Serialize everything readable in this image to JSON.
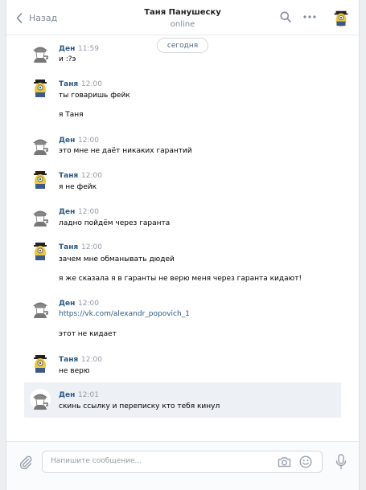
{
  "header": {
    "back_label": "Назад",
    "title": "Таня Панушеску",
    "status": "online"
  },
  "date_pill": "сегодня",
  "messages": [
    {
      "name": "Ден",
      "time": "11:59",
      "lines": [
        "и :?э"
      ]
    },
    {
      "name": "Таня",
      "time": "12:00",
      "lines": [
        "ты говаришь фейк",
        "я Таня"
      ]
    },
    {
      "name": "Ден",
      "time": "12:00",
      "lines": [
        "это мне не даёт никаких гарантий"
      ]
    },
    {
      "name": "Таня",
      "time": "12:00",
      "lines": [
        "я не фейк"
      ]
    },
    {
      "name": "Ден",
      "time": "12:00",
      "lines": [
        "ладно пойдём через гаранта"
      ]
    },
    {
      "name": "Таня",
      "time": "12:00",
      "lines": [
        "зачем мне обманывать дюдей",
        "я же сказала я в гаранты не верю меня через гаранта кидают!"
      ]
    },
    {
      "name": "Ден",
      "time": "12:00",
      "link": "https://vk.com/alexandr_popovich_1",
      "lines": [
        "этот не кидает"
      ]
    },
    {
      "name": "Таня",
      "time": "12:00",
      "lines": [
        "не верю"
      ]
    },
    {
      "name": "Ден",
      "time": "12:01",
      "lines": [
        "скинь ссылку и переписку кто тебя кинул"
      ]
    }
  ],
  "composer": {
    "placeholder": "Напишите сообщение..."
  },
  "colors": {
    "name_blue": "#2a5885",
    "muted": "#828a99",
    "highlight_row": "#edf0f5"
  },
  "icons": [
    "chevron-left-icon",
    "search-icon",
    "more-icon",
    "paperclip-icon",
    "camera-icon",
    "smile-icon",
    "microphone-icon"
  ]
}
